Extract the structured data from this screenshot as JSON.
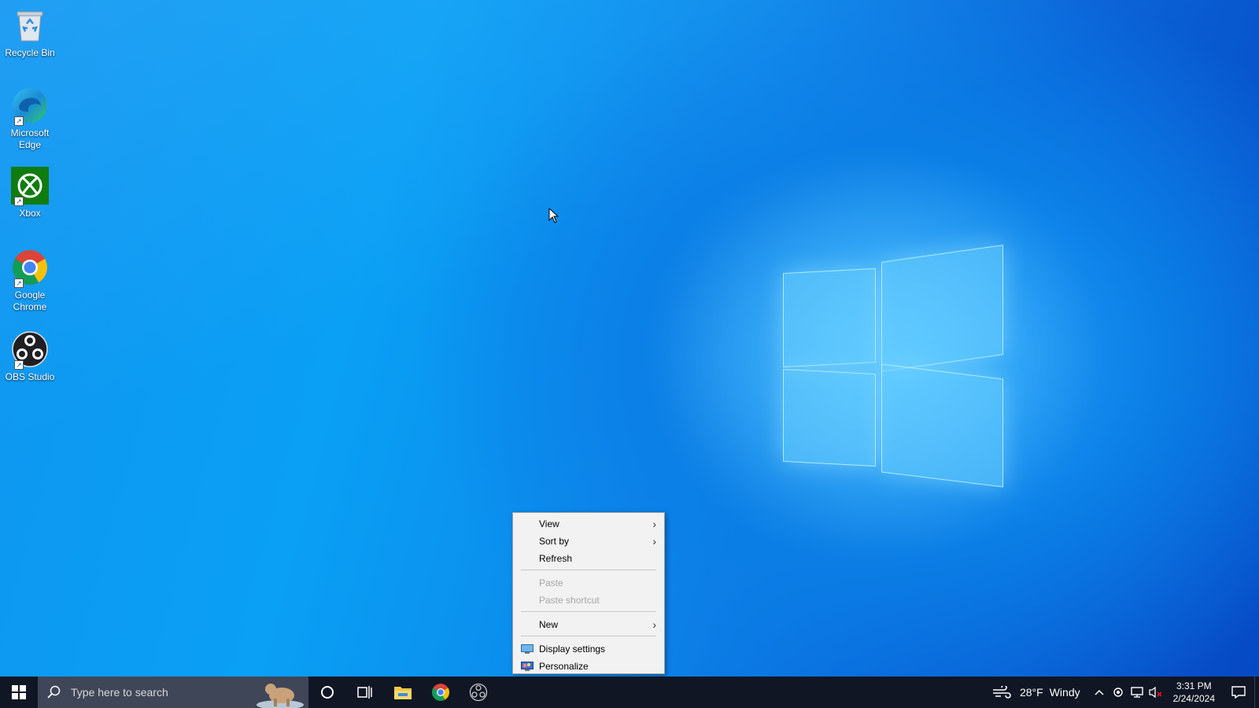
{
  "desktop_icons": [
    {
      "label": "Recycle Bin",
      "icon": "recycle-bin-icon"
    },
    {
      "label": "Microsoft Edge",
      "icon": "edge-icon"
    },
    {
      "label": "Xbox",
      "icon": "xbox-icon"
    },
    {
      "label": "Google Chrome",
      "icon": "chrome-icon"
    },
    {
      "label": "OBS Studio",
      "icon": "obs-icon"
    }
  ],
  "context_menu": {
    "view": "View",
    "sort_by": "Sort by",
    "refresh": "Refresh",
    "paste": "Paste",
    "paste_shortcut": "Paste shortcut",
    "new": "New",
    "display_settings": "Display settings",
    "personalize": "Personalize"
  },
  "taskbar": {
    "search_placeholder": "Type here to search",
    "weather_temp": "28°F",
    "weather_desc": "Windy",
    "time": "3:31 PM",
    "date": "2/24/2024"
  },
  "colors": {
    "taskbar_bg": "#101624",
    "search_bg": "#3f4658",
    "menu_bg": "#f2f2f2"
  }
}
